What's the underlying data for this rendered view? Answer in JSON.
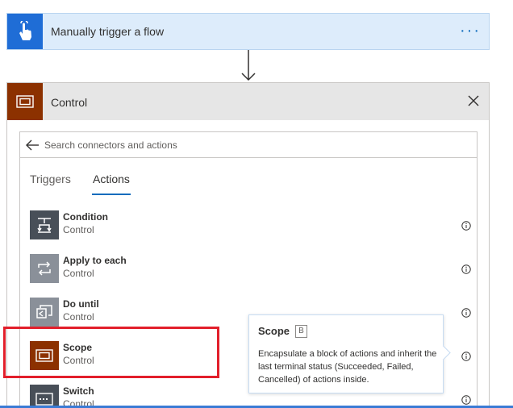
{
  "trigger": {
    "title": "Manually trigger a flow",
    "more_label": "···",
    "icon": "touch-hand-icon",
    "color": "#1f6dd6"
  },
  "control": {
    "title": "Control",
    "icon": "scope-icon",
    "color": "#8c3100"
  },
  "search": {
    "placeholder": "Search connectors and actions"
  },
  "tabs": [
    {
      "label": "Triggers",
      "selected": false
    },
    {
      "label": "Actions",
      "selected": true
    }
  ],
  "actions": [
    {
      "name": "Condition",
      "connector": "Control",
      "icon": "condition-icon",
      "color": "#484f58"
    },
    {
      "name": "Apply to each",
      "connector": "Control",
      "icon": "loop-icon",
      "color": "#8a9099"
    },
    {
      "name": "Do until",
      "connector": "Control",
      "icon": "do-until-icon",
      "color": "#8a9099"
    },
    {
      "name": "Scope",
      "connector": "Control",
      "icon": "scope-icon",
      "color": "#8c3100"
    },
    {
      "name": "Switch",
      "connector": "Control",
      "icon": "switch-icon",
      "color": "#484f58"
    }
  ],
  "tooltip": {
    "title": "Scope",
    "key": "B",
    "description": "Encapsulate a block of actions and inherit the last terminal status (Succeeded, Failed, Cancelled) of actions inside."
  },
  "colors": {
    "accent": "#0f6cbd",
    "highlight": "#e21f2b"
  }
}
